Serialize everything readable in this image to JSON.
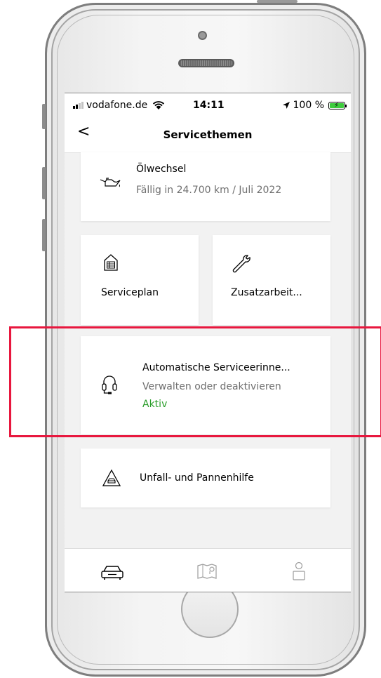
{
  "status_bar": {
    "carrier": "vodafone.de",
    "time": "14:11",
    "battery": "100 %"
  },
  "nav": {
    "back_label": "<",
    "title": "Servicethemen"
  },
  "cards": {
    "oil_change": {
      "icon": "oil-can-icon",
      "title": "Ölwechsel",
      "subtitle": "Fällig in 24.700 km / Juli 2022"
    },
    "service_plan": {
      "icon": "service-plan-icon",
      "title": "Serviceplan"
    },
    "additional_work": {
      "icon": "wrench-icon",
      "title": "Zusatzarbeit..."
    },
    "auto_service_reminder": {
      "icon": "headset-icon",
      "title": "Automatische Serviceerinne...",
      "subtitle": "Verwalten oder deaktivieren",
      "status": "Aktiv"
    },
    "accident_help": {
      "icon": "warning-triangle-car-icon",
      "title": "Unfall- und Pannenhilfe"
    }
  },
  "tab_bar": {
    "items": [
      {
        "icon": "car-icon",
        "active": true
      },
      {
        "icon": "map-icon",
        "active": false
      },
      {
        "icon": "profile-icon",
        "active": false
      }
    ]
  },
  "colors": {
    "highlight": "#e8173e",
    "active_status": "#2a9d2a",
    "screen_background": "#f2f2f2"
  }
}
